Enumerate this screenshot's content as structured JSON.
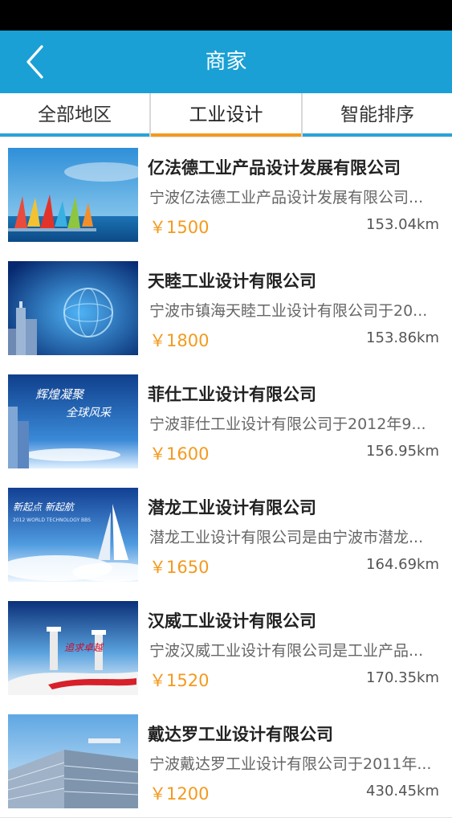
{
  "header": {
    "title": "商家",
    "back_icon": "chevron-left-icon"
  },
  "tabs": [
    {
      "label": "全部地区",
      "active": false
    },
    {
      "label": "工业设计",
      "active": true
    },
    {
      "label": "智能排序",
      "active": false
    }
  ],
  "colors": {
    "brand": "#1aa0d4",
    "accent": "#f39a1e",
    "price": "#f39a1e"
  },
  "merchants": [
    {
      "name": "亿法德工业产品设计发展有限公司",
      "description": "宁波亿法德工业产品设计发展有限公司...",
      "price": "￥1500",
      "distance": "153.04km"
    },
    {
      "name": "天睦工业设计有限公司",
      "description": "宁波市镇海天睦工业设计有限公司于20...",
      "price": "￥1800",
      "distance": "153.86km"
    },
    {
      "name": "菲仕工业设计有限公司",
      "description": "宁波菲仕工业设计有限公司于2012年9...",
      "price": "￥1600",
      "distance": "156.95km",
      "thumb_text": [
        "辉煌凝聚",
        "全球风采"
      ]
    },
    {
      "name": "潜龙工业设计有限公司",
      "description": "潜龙工业设计有限公司是由宁波市潜龙...",
      "price": "￥1650",
      "distance": "164.69km",
      "thumb_text": [
        "新起点 新起航",
        "2012 WORLD TECHNOLOGY BBS"
      ]
    },
    {
      "name": "汉威工业设计有限公司",
      "description": "宁波汉威工业设计有限公司是工业产品...",
      "price": "￥1520",
      "distance": "170.35km",
      "thumb_text": [
        "追求卓越"
      ]
    },
    {
      "name": "戴达罗工业设计有限公司",
      "description": "宁波戴达罗工业设计有限公司于2011年...",
      "price": "￥1200",
      "distance": "430.45km"
    }
  ]
}
